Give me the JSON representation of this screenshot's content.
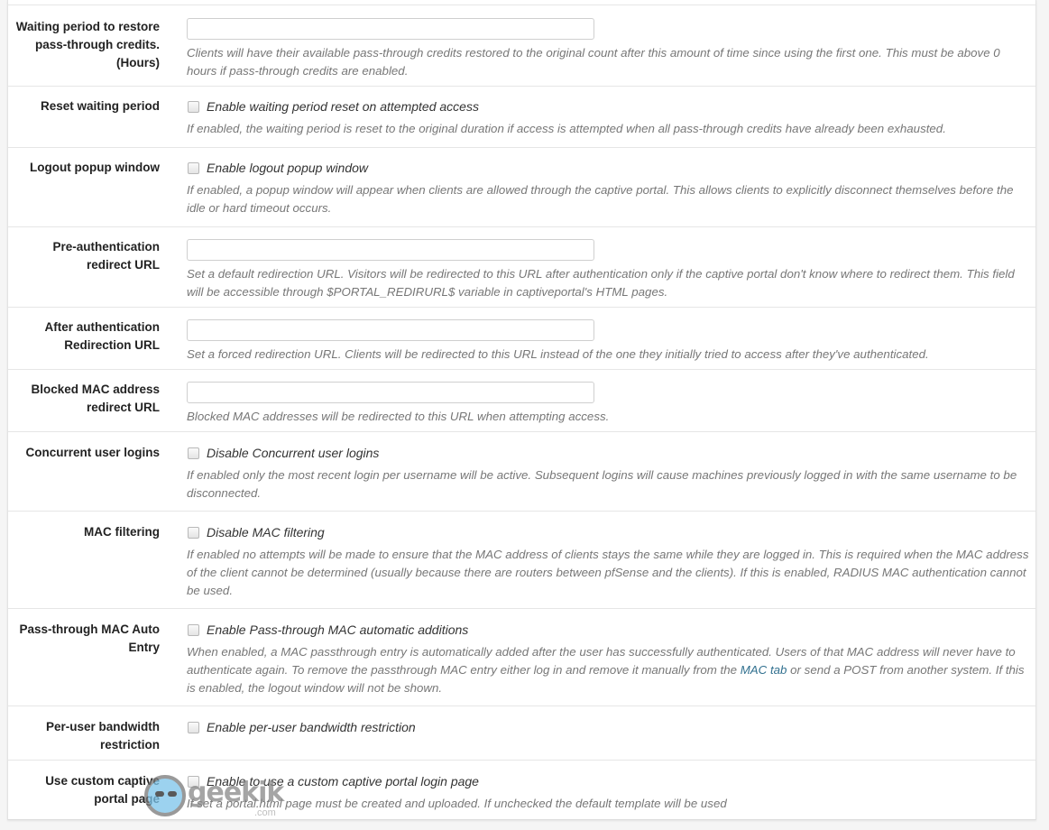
{
  "rows": [
    {
      "label": "Waiting period to restore pass-through credits. (Hours)",
      "type": "input",
      "value": "",
      "help": "Clients will have their available pass-through credits restored to the original count after this amount of time since using the first one. This must be above 0 hours if pass-through credits are enabled."
    },
    {
      "label": "Reset waiting period",
      "type": "checkbox",
      "checked": false,
      "check_label": "Enable waiting period reset on attempted access",
      "help": "If enabled, the waiting period is reset to the original duration if access is attempted when all pass-through credits have already been exhausted."
    },
    {
      "label": "Logout popup window",
      "type": "checkbox",
      "checked": false,
      "check_label": "Enable logout popup window",
      "help": "If enabled, a popup window will appear when clients are allowed through the captive portal. This allows clients to explicitly disconnect themselves before the idle or hard timeout occurs."
    },
    {
      "label": "Pre-authentication redirect URL",
      "type": "input",
      "value": "",
      "help": "Set a default redirection URL. Visitors will be redirected to this URL after authentication only if the captive portal don't know where to redirect them. This field will be accessible through $PORTAL_REDIRURL$ variable in captiveportal's HTML pages."
    },
    {
      "label": "After authentication Redirection URL",
      "type": "input",
      "value": "",
      "help": "Set a forced redirection URL. Clients will be redirected to this URL instead of the one they initially tried to access after they've authenticated."
    },
    {
      "label": "Blocked MAC address redirect URL",
      "type": "input",
      "value": "",
      "help": "Blocked MAC addresses will be redirected to this URL when attempting access."
    },
    {
      "label": "Concurrent user logins",
      "type": "checkbox",
      "checked": false,
      "check_label": "Disable Concurrent user logins",
      "help": "If enabled only the most recent login per username will be active. Subsequent logins will cause machines previously logged in with the same username to be disconnected."
    },
    {
      "label": "MAC filtering",
      "type": "checkbox",
      "checked": false,
      "check_label": "Disable MAC filtering",
      "help": "If enabled no attempts will be made to ensure that the MAC address of clients stays the same while they are logged in. This is required when the MAC address of the client cannot be determined (usually because there are routers between pfSense and the clients). If this is enabled, RADIUS MAC authentication cannot be used."
    },
    {
      "label": "Pass-through MAC Auto Entry",
      "type": "checkbox",
      "checked": false,
      "check_label": "Enable Pass-through MAC automatic additions",
      "help_before_link": "When enabled, a MAC passthrough entry is automatically added after the user has successfully authenticated. Users of that MAC address will never have to authenticate again. To remove the passthrough MAC entry either log in and remove it manually from the ",
      "help_link": "MAC tab",
      "help_after_link": " or send a POST from another system. If this is enabled, the logout window will not be shown."
    },
    {
      "label": "Per-user bandwidth restriction",
      "type": "checkbox",
      "checked": false,
      "check_label": "Enable per-user bandwidth restriction",
      "help": ""
    },
    {
      "label": "Use custom captive portal page",
      "type": "checkbox",
      "checked": false,
      "check_label": "Enable to use a custom captive portal login page",
      "help": "If set a portal.html page must be created and uploaded. If unchecked the default template will be used"
    }
  ],
  "watermark": {
    "text": "geekik",
    "suffix": ".com"
  },
  "colors": {
    "link": "#31708f",
    "help_text": "#777777",
    "label_text": "#222222",
    "border": "#e6e6e6"
  }
}
